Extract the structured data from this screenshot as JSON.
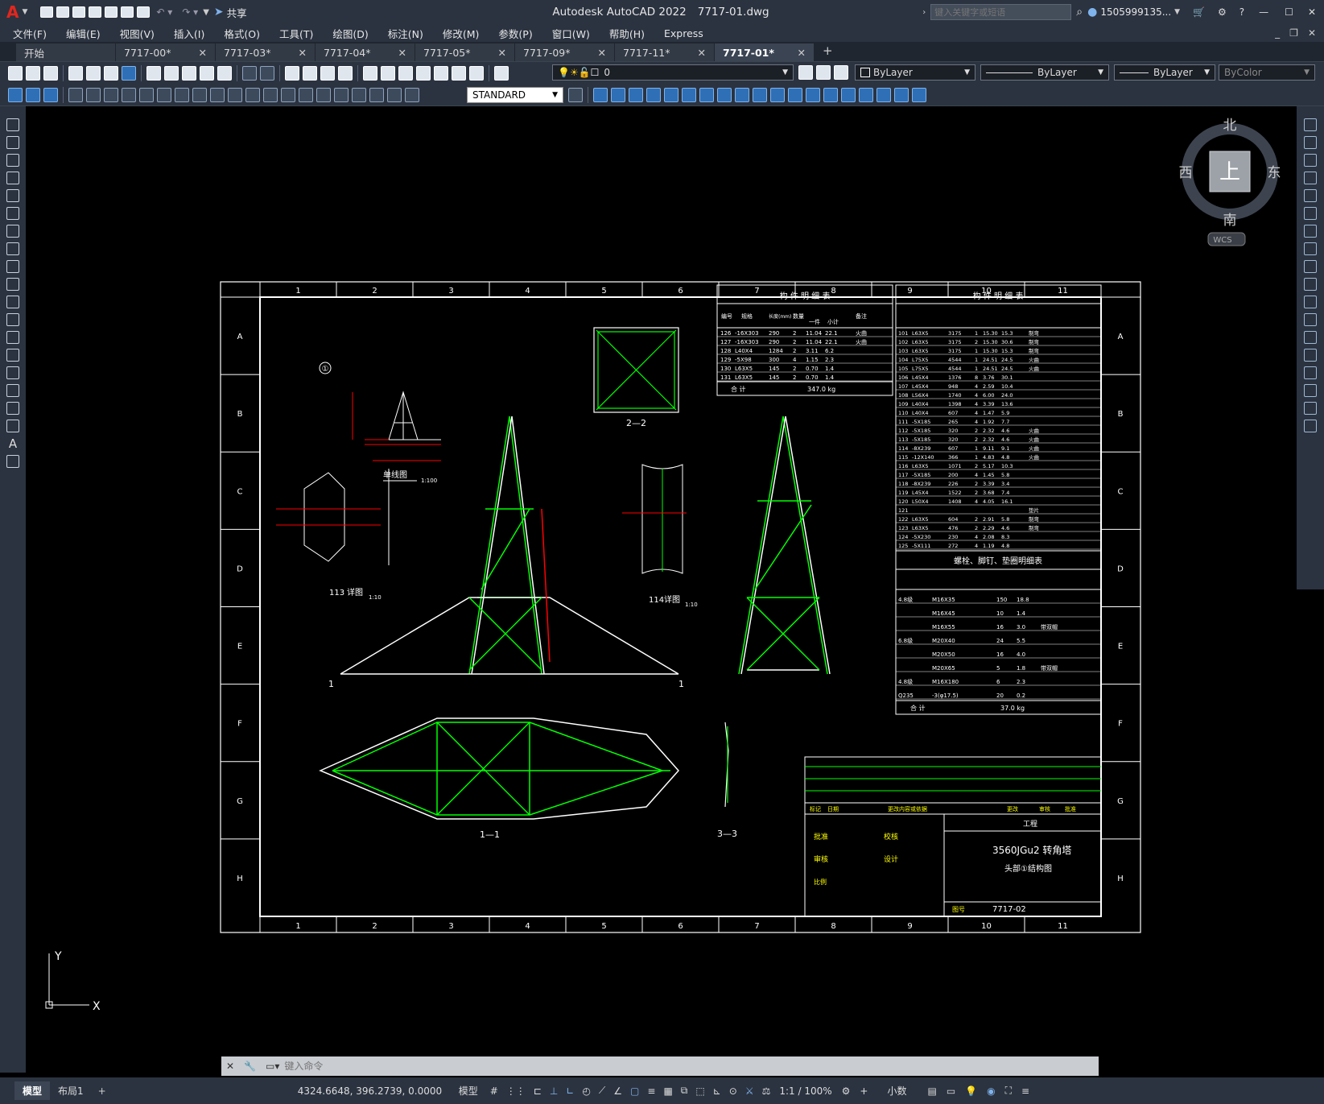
{
  "app": {
    "title": "Autodesk AutoCAD 2022",
    "filename": "7717-01.dwg",
    "share_label": "共享",
    "search_placeholder": "键入关键字或短语",
    "user": "1505999135...",
    "logo": "A"
  },
  "menu": [
    "文件(F)",
    "编辑(E)",
    "视图(V)",
    "插入(I)",
    "格式(O)",
    "工具(T)",
    "绘图(D)",
    "标注(N)",
    "修改(M)",
    "参数(P)",
    "窗口(W)",
    "帮助(H)",
    "Express"
  ],
  "tabs": [
    {
      "label": "开始",
      "close": ""
    },
    {
      "label": "7717-00*",
      "close": "✕"
    },
    {
      "label": "7717-03*",
      "close": "✕"
    },
    {
      "label": "7717-04*",
      "close": "✕"
    },
    {
      "label": "7717-05*",
      "close": "✕"
    },
    {
      "label": "7717-09*",
      "close": "✕"
    },
    {
      "label": "7717-11*",
      "close": "✕"
    },
    {
      "label": "7717-01*",
      "close": "✕"
    }
  ],
  "toolbar": {
    "layer_value": "0",
    "color_value": "ByLayer",
    "linetype_value": "ByLayer",
    "lineweight_value": "ByLayer",
    "plotstyle_value": "ByColor",
    "textstyle_value": "STANDARD"
  },
  "viewcube": {
    "north": "北",
    "south": "南",
    "east": "东",
    "west": "西",
    "top": "上",
    "wcs": "WCS"
  },
  "ucs": {
    "y": "Y",
    "x": "X"
  },
  "command": {
    "placeholder": "键入命令"
  },
  "status": {
    "tabs": [
      "模型",
      "布局1"
    ],
    "coords": "4324.6648, 396.2739, 0.0000",
    "mode": "模型",
    "scale": "1:1 / 100%",
    "units": "小数"
  },
  "drawing": {
    "col_labels": [
      "1",
      "2",
      "3",
      "4",
      "5",
      "6",
      "7",
      "8",
      "9",
      "10",
      "11"
    ],
    "row_labels": [
      "A",
      "B",
      "C",
      "D",
      "E",
      "F",
      "G",
      "H"
    ],
    "views": {
      "single_line": "单线图",
      "section_22": "2—2",
      "section_11": "1—1",
      "section_33": "3—3",
      "detail_113": "113",
      "detail_114": "114",
      "detail_suffix": "详图",
      "scale_100": "1:100",
      "scale_10": "1:10",
      "circle_1": "①"
    },
    "table1": {
      "title": "构 件 明 细 表",
      "headers": [
        "编号",
        "规格",
        "长度(mm)",
        "数量",
        "一件",
        "小计",
        "备注"
      ],
      "rows": [
        [
          "126",
          "-16X303",
          "290",
          "2",
          "11.04",
          "22.1",
          "火曲"
        ],
        [
          "127",
          "-16X303",
          "290",
          "2",
          "11.04",
          "22.1",
          "火曲"
        ],
        [
          "128",
          "L40X4",
          "1284",
          "2",
          "3.11",
          "6.2",
          ""
        ],
        [
          "129",
          "-5X98",
          "300",
          "4",
          "1.15",
          "2.3",
          ""
        ],
        [
          "130",
          "L63X5",
          "145",
          "2",
          "0.70",
          "1.4",
          ""
        ],
        [
          "131",
          "L63X5",
          "145",
          "2",
          "0.70",
          "1.4",
          ""
        ]
      ],
      "total_label": "合 计",
      "total": "347.0 kg"
    },
    "table2": {
      "title": "构 件 明 细 表",
      "rows": [
        [
          "101",
          "L63X5",
          "3175",
          "1",
          "15.30",
          "15.3",
          "制弯"
        ],
        [
          "102",
          "L63X5",
          "3175",
          "2",
          "15.30",
          "30.6",
          "制弯"
        ],
        [
          "103",
          "L63X5",
          "3175",
          "1",
          "15.30",
          "15.3",
          "制弯"
        ],
        [
          "104",
          "L75X5",
          "4544",
          "1",
          "24.51",
          "24.5",
          "火曲"
        ],
        [
          "105",
          "L75X5",
          "4544",
          "1",
          "24.51",
          "24.5",
          "火曲"
        ],
        [
          "106",
          "L45X4",
          "1376",
          "8",
          "3.76",
          "30.1",
          ""
        ],
        [
          "107",
          "L45X4",
          "948",
          "4",
          "2.59",
          "10.4",
          ""
        ],
        [
          "108",
          "L56X4",
          "1740",
          "4",
          "6.00",
          "24.0",
          ""
        ],
        [
          "109",
          "L40X4",
          "1398",
          "4",
          "3.39",
          "13.6",
          ""
        ],
        [
          "110",
          "L40X4",
          "607",
          "4",
          "1.47",
          "5.9",
          ""
        ],
        [
          "111",
          "-5X185",
          "265",
          "4",
          "1.92",
          "7.7",
          ""
        ],
        [
          "112",
          "-5X185",
          "320",
          "2",
          "2.32",
          "4.6",
          "火曲"
        ],
        [
          "113",
          "-5X185",
          "320",
          "2",
          "2.32",
          "4.6",
          "火曲"
        ],
        [
          "114",
          "-8X239",
          "607",
          "1",
          "9.11",
          "9.1",
          "火曲"
        ],
        [
          "115",
          "-12X140",
          "366",
          "1",
          "4.83",
          "4.8",
          "火曲"
        ],
        [
          "116",
          "L63X5",
          "1071",
          "2",
          "5.17",
          "10.3",
          ""
        ],
        [
          "117",
          "-5X185",
          "200",
          "4",
          "1.45",
          "5.8",
          ""
        ],
        [
          "118",
          "-8X239",
          "226",
          "2",
          "3.39",
          "3.4",
          ""
        ],
        [
          "119",
          "L45X4",
          "1522",
          "2",
          "3.68",
          "7.4",
          ""
        ],
        [
          "120",
          "L50X4",
          "1408",
          "4",
          "4.05",
          "16.1",
          ""
        ],
        [
          "121",
          "",
          "",
          "",
          "",
          "",
          "垫片"
        ],
        [
          "122",
          "L63X5",
          "604",
          "2",
          "2.91",
          "5.8",
          "制弯"
        ],
        [
          "123",
          "L63X5",
          "476",
          "2",
          "2.29",
          "4.6",
          "制弯"
        ],
        [
          "124",
          "-5X230",
          "230",
          "4",
          "2.08",
          "8.3",
          ""
        ],
        [
          "125",
          "-5X111",
          "272",
          "4",
          "1.19",
          "4.8",
          ""
        ]
      ]
    },
    "bolt_table": {
      "title": "螺栓、脚钉、垫圈明细表",
      "rows": [
        [
          "4.8级",
          "M16X35",
          "150",
          "18.8",
          ""
        ],
        [
          "",
          "M16X45",
          "10",
          "1.4",
          ""
        ],
        [
          "",
          "M16X55",
          "16",
          "3.0",
          "带双帽"
        ],
        [
          "6.8级",
          "M20X40",
          "24",
          "5.5",
          ""
        ],
        [
          "",
          "M20X50",
          "16",
          "4.0",
          ""
        ],
        [
          "",
          "M20X65",
          "5",
          "1.8",
          "带双帽"
        ],
        [
          "4.8级",
          "M16X180",
          "6",
          "2.3",
          ""
        ],
        [
          "Q235",
          "-3(φ17.5)",
          "20",
          "0.2",
          ""
        ]
      ],
      "total_label": "合 计",
      "total": "37.0 kg"
    },
    "title_block": {
      "project_label": "工程",
      "tower": "3560JGu2 转角塔",
      "part": "头部①结构图",
      "drawing_no": "7717-02",
      "approve": "批准",
      "check": "校核",
      "review": "审核",
      "design": "设计",
      "scale_label": "比例",
      "drawing_label": "图号",
      "rev_headers": [
        "标记",
        "日期",
        "更改内容或依据",
        "更改",
        "审核",
        "批准"
      ]
    }
  }
}
